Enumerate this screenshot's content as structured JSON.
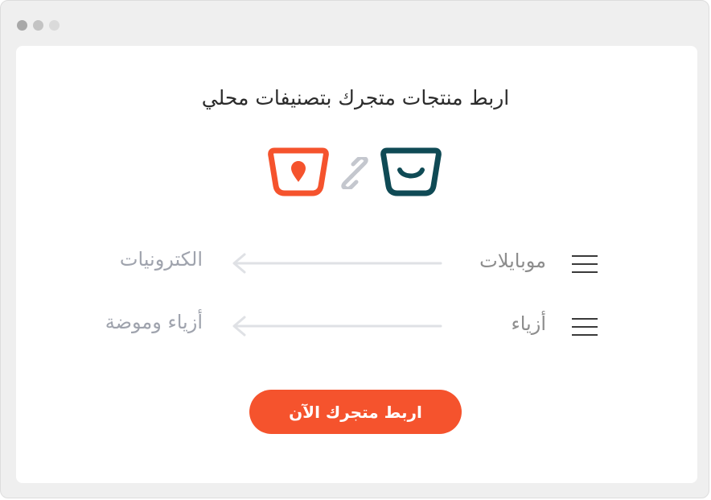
{
  "window": {
    "traffic_lights": [
      "dot",
      "dot",
      "dot"
    ]
  },
  "card": {
    "title": "اربط منتجات متجرك بتصنيفات محلي",
    "icons": {
      "left_logo": "orange-shopping-bag-pin-icon",
      "middle": "link-chain-icon",
      "right_logo": "teal-smile-bag-icon"
    },
    "colors": {
      "accent": "#f5532d",
      "teal": "#0f4a55",
      "link_gray": "#c4c7ce",
      "arrow_gray": "#dfe1e5"
    },
    "mappings": [
      {
        "source": "موبايلات",
        "target": "الكترونيات"
      },
      {
        "source": "أزياء",
        "target": "أزياء وموضة"
      }
    ],
    "cta_label": "اربط متجرك الآن"
  }
}
